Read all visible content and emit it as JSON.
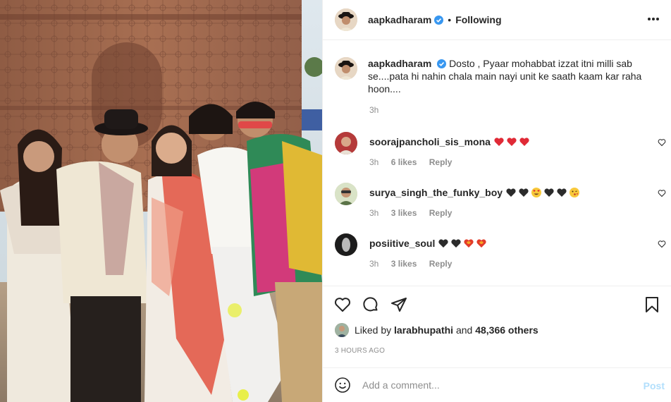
{
  "post": {
    "username": "aapkadharam",
    "follow_status": "Following",
    "separator": "•",
    "verified": true,
    "icons": {
      "more": "more-options-icon",
      "verified": "verified-badge-icon"
    }
  },
  "caption": {
    "username": "aapkadharam",
    "text": "Dosto , Pyaar mohabbat izzat itni milli sab se....pata hi nahin chala main nayi unit ke saath kaam kar raha hoon....",
    "time": "3h"
  },
  "comments": [
    {
      "username": "soorajpancholi_sis_mona",
      "emojis": [
        "red-heart",
        "red-heart",
        "red-heart"
      ],
      "time": "3h",
      "likes": "6 likes",
      "reply": "Reply"
    },
    {
      "username": "surya_singh_the_funky_boy",
      "emojis": [
        "black-heart",
        "black-heart",
        "heart-eyes",
        "black-heart",
        "black-heart",
        "kissing-face"
      ],
      "time": "3h",
      "likes": "3 likes",
      "reply": "Reply"
    },
    {
      "username": "posiitive_soul",
      "emojis": [
        "black-heart",
        "black-heart",
        "heart-on-fire",
        "heart-on-fire"
      ],
      "time": "3h",
      "likes": "3 likes",
      "reply": "Reply"
    }
  ],
  "actions": {
    "icons": [
      "heart-icon",
      "comment-icon",
      "share-icon",
      "bookmark-icon"
    ]
  },
  "likes": {
    "prefix": "Liked by",
    "user": "larabhupathi",
    "conj": "and",
    "others": "48,366 others"
  },
  "timestamp": "3 hours ago",
  "add_comment": {
    "placeholder": "Add a comment...",
    "post_label": "Post",
    "post_color": "#b2dffc"
  },
  "colors": {
    "text": "#262626",
    "muted": "#8e8e8e",
    "verified": "#3897f0",
    "divider": "#efefef"
  }
}
